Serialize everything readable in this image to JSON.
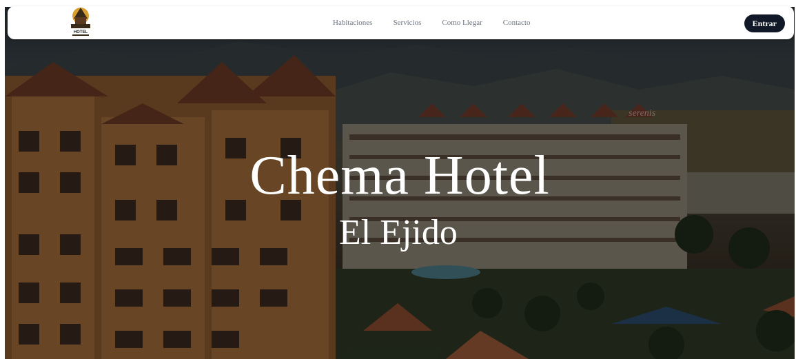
{
  "brand": {
    "logo_text": "HOTEL"
  },
  "nav": {
    "links": [
      {
        "label": "Habitaciones"
      },
      {
        "label": "Servicios"
      },
      {
        "label": "Como Llegar"
      },
      {
        "label": "Contacto"
      }
    ],
    "login_label": "Entrar"
  },
  "hero": {
    "title": "Chema Hotel",
    "subtitle": "El Ejido",
    "background_sign": "serenis"
  },
  "colors": {
    "nav_bg": "#ffffff",
    "button_bg": "#111827",
    "nav_text": "#6b7280",
    "hero_text": "#ffffff"
  }
}
